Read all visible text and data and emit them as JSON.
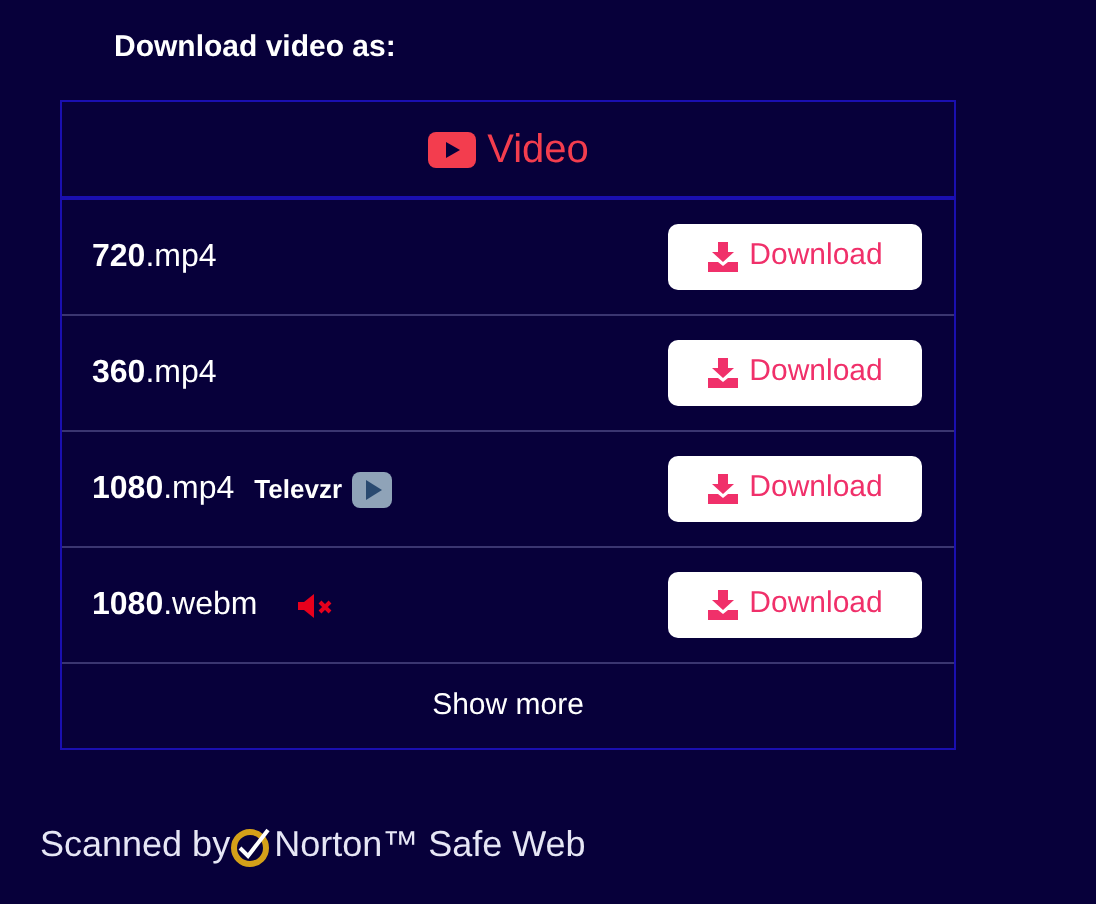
{
  "heading": "Download video as:",
  "section": {
    "title": "Video"
  },
  "rows": [
    {
      "format": "**720**.mp4",
      "button": "Download"
    },
    {
      "format": "**360**.mp4",
      "button": "Download"
    },
    {
      "format": "**1080**.mp4",
      "button": "Download",
      "extra": {
        "kind": "app",
        "label": "Televzr"
      }
    },
    {
      "format": "**1080**.webm",
      "button": "Download",
      "extra": {
        "kind": "muted"
      }
    }
  ],
  "show_more": "Show more",
  "footer": {
    "prefix": "Scanned by",
    "brand": "Norton™ Safe Web"
  }
}
